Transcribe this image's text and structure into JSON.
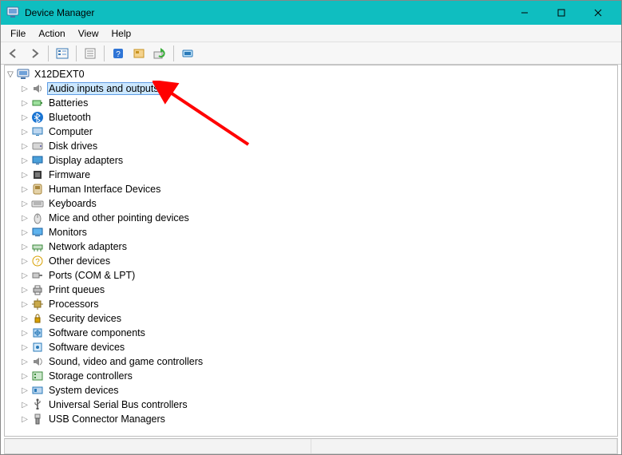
{
  "window": {
    "title": "Device Manager"
  },
  "menus": [
    "File",
    "Action",
    "View",
    "Help"
  ],
  "toolbar_icons": [
    "back-icon",
    "forward-icon",
    "sep",
    "tree-view-icon",
    "sep",
    "properties-icon",
    "sep",
    "help-icon",
    "disable-icon",
    "update-driver-icon",
    "sep",
    "scan-hardware-icon"
  ],
  "tree": {
    "root": {
      "label": "X12DEXT0",
      "icon": "computer-icon"
    },
    "categories": [
      {
        "label": "Audio inputs and outputs",
        "icon": "audio-icon",
        "selected": true
      },
      {
        "label": "Batteries",
        "icon": "battery-icon"
      },
      {
        "label": "Bluetooth",
        "icon": "bluetooth-icon"
      },
      {
        "label": "Computer",
        "icon": "computer-small-icon"
      },
      {
        "label": "Disk drives",
        "icon": "disk-icon"
      },
      {
        "label": "Display adapters",
        "icon": "display-icon"
      },
      {
        "label": "Firmware",
        "icon": "firmware-icon"
      },
      {
        "label": "Human Interface Devices",
        "icon": "hid-icon"
      },
      {
        "label": "Keyboards",
        "icon": "keyboard-icon"
      },
      {
        "label": "Mice and other pointing devices",
        "icon": "mouse-icon"
      },
      {
        "label": "Monitors",
        "icon": "monitor-icon"
      },
      {
        "label": "Network adapters",
        "icon": "network-icon"
      },
      {
        "label": "Other devices",
        "icon": "other-icon"
      },
      {
        "label": "Ports (COM & LPT)",
        "icon": "ports-icon"
      },
      {
        "label": "Print queues",
        "icon": "printer-icon"
      },
      {
        "label": "Processors",
        "icon": "processor-icon"
      },
      {
        "label": "Security devices",
        "icon": "security-icon"
      },
      {
        "label": "Software components",
        "icon": "software-comp-icon"
      },
      {
        "label": "Software devices",
        "icon": "software-dev-icon"
      },
      {
        "label": "Sound, video and game controllers",
        "icon": "sound-icon"
      },
      {
        "label": "Storage controllers",
        "icon": "storage-icon"
      },
      {
        "label": "System devices",
        "icon": "system-icon"
      },
      {
        "label": "Universal Serial Bus controllers",
        "icon": "usb-icon"
      },
      {
        "label": "USB Connector Managers",
        "icon": "usb-conn-icon"
      }
    ]
  },
  "arrow": {
    "color": "#ff0000"
  }
}
